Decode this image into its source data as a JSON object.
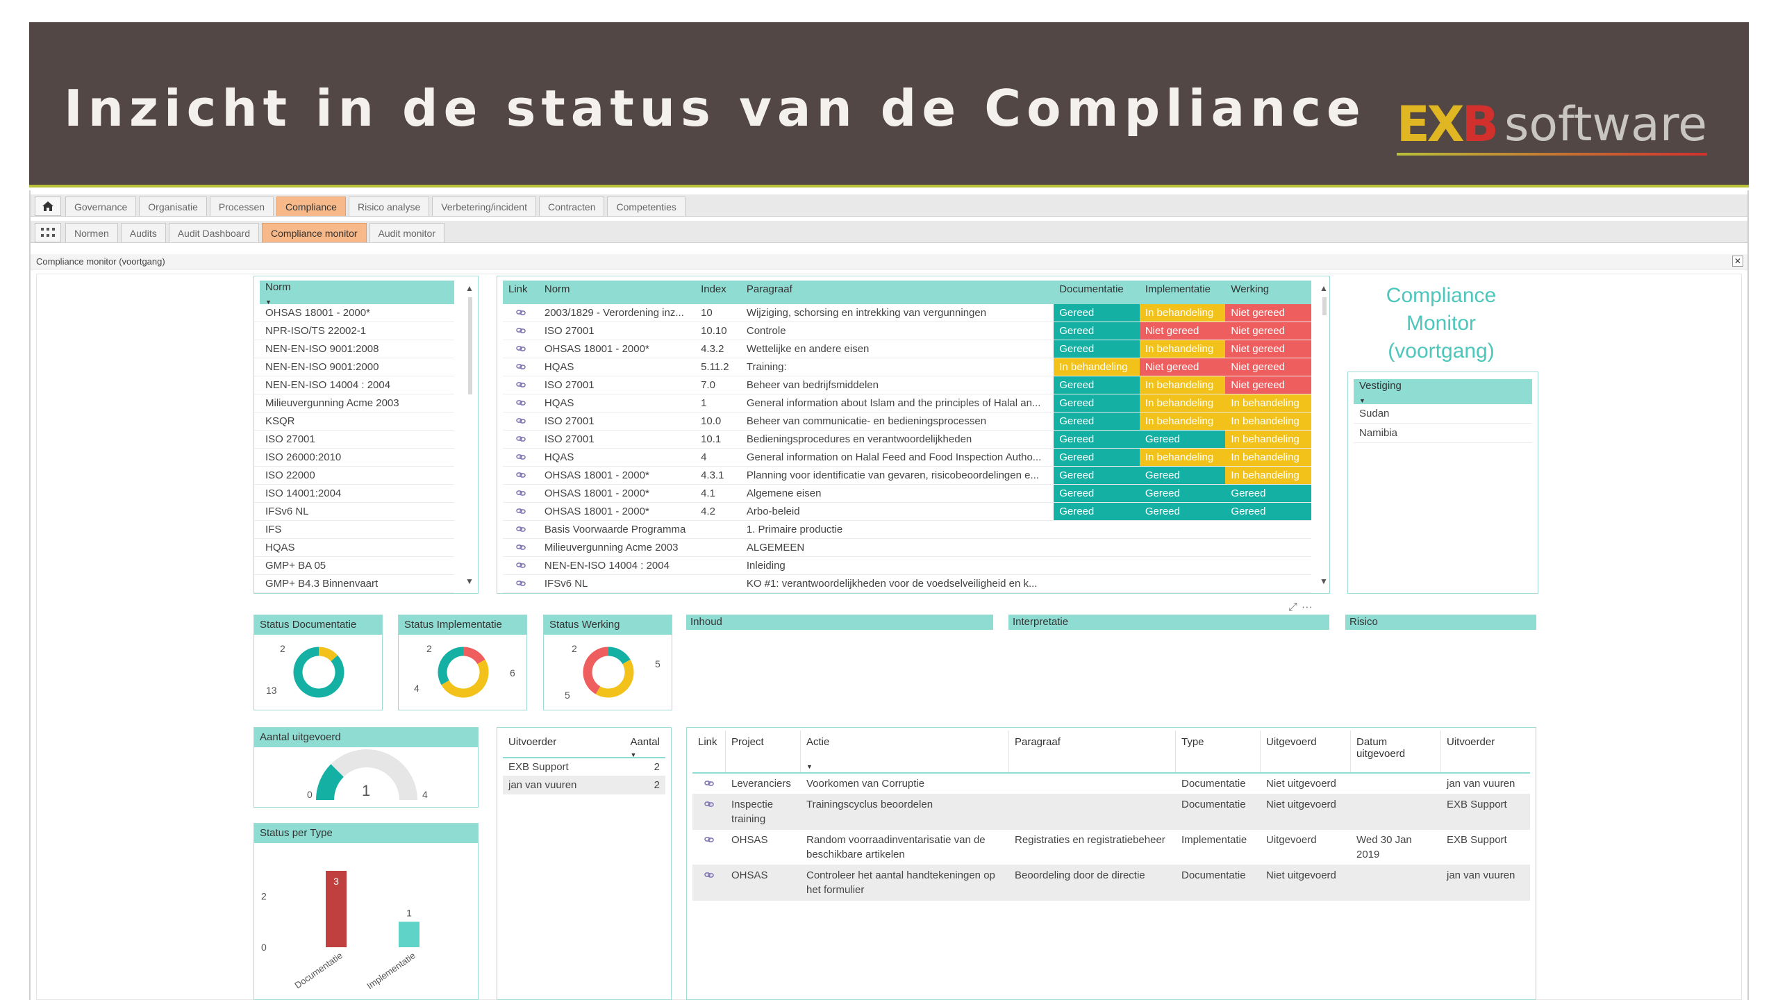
{
  "banner": {
    "title": "Inzicht in de status van de Compliance",
    "logo_ex": "EX",
    "logo_b": "B",
    "logo_software": "software"
  },
  "tabs_top": [
    {
      "label": "Governance"
    },
    {
      "label": "Organisatie"
    },
    {
      "label": "Processen"
    },
    {
      "label": "Compliance",
      "active": true
    },
    {
      "label": "Risico analyse"
    },
    {
      "label": "Verbetering/incident"
    },
    {
      "label": "Contracten"
    },
    {
      "label": "Competenties"
    }
  ],
  "tabs_sub": [
    {
      "label": "Normen"
    },
    {
      "label": "Audits"
    },
    {
      "label": "Audit Dashboard"
    },
    {
      "label": "Compliance monitor",
      "active": true
    },
    {
      "label": "Audit monitor"
    }
  ],
  "page_title": "Compliance monitor (voortgang)",
  "icons": {
    "home": "home-icon",
    "apps": "grid-icon",
    "close": "close-icon",
    "link": "link-icon"
  },
  "norm_list": {
    "header": "Norm",
    "items": [
      "OHSAS 18001 - 2000*",
      "NPR-ISO/TS 22002-1",
      "NEN-EN-ISO 9001:2008",
      "NEN-EN-ISO 9001:2000",
      "NEN-EN-ISO 14004 : 2004",
      "Milieuvergunning Acme 2003",
      "KSQR",
      "ISO 27001",
      "ISO 26000:2010",
      "ISO 22000",
      "ISO 14001:2004",
      "IFSv6 NL",
      "IFS",
      "HQAS",
      "GMP+ BA 05",
      "GMP+ B4.3 Binnenvaart"
    ]
  },
  "norm_table": {
    "headers": {
      "link": "Link",
      "norm": "Norm",
      "index": "Index",
      "paragraaf": "Paragraaf",
      "doc": "Documentatie",
      "impl": "Implementatie",
      "werk": "Werking"
    },
    "rows": [
      {
        "norm": "2003/1829 - Verordening inz...",
        "index": "10",
        "par": "Wijziging, schorsing en intrekking van vergunningen",
        "doc": "Gereed",
        "impl": "In behandeling",
        "werk": "Niet gereed"
      },
      {
        "norm": "ISO 27001",
        "index": "10.10",
        "par": "Controle",
        "doc": "Gereed",
        "impl": "Niet gereed",
        "werk": "Niet gereed"
      },
      {
        "norm": "OHSAS 18001 - 2000*",
        "index": "4.3.2",
        "par": "Wettelijke en andere eisen",
        "doc": "Gereed",
        "impl": "In behandeling",
        "werk": "Niet gereed"
      },
      {
        "norm": "HQAS",
        "index": "5.11.2",
        "par": "Training:",
        "doc": "In behandeling",
        "impl": "Niet gereed",
        "werk": "Niet gereed"
      },
      {
        "norm": "ISO 27001",
        "index": "7.0",
        "par": "Beheer van bedrijfsmiddelen",
        "doc": "Gereed",
        "impl": "In behandeling",
        "werk": "Niet gereed"
      },
      {
        "norm": "HQAS",
        "index": "1",
        "par": "General information about Islam and the principles of Halal an...",
        "doc": "Gereed",
        "impl": "In behandeling",
        "werk": "In behandeling"
      },
      {
        "norm": "ISO 27001",
        "index": "10.0",
        "par": "Beheer van communicatie- en bedieningsprocessen",
        "doc": "Gereed",
        "impl": "In behandeling",
        "werk": "In behandeling"
      },
      {
        "norm": "ISO 27001",
        "index": "10.1",
        "par": "Bedieningsprocedures en verantwoordelijkheden",
        "doc": "Gereed",
        "impl": "Gereed",
        "werk": "In behandeling"
      },
      {
        "norm": "HQAS",
        "index": "4",
        "par": "General information on Halal Feed and Food Inspection Autho...",
        "doc": "Gereed",
        "impl": "In behandeling",
        "werk": "In behandeling"
      },
      {
        "norm": "OHSAS 18001 - 2000*",
        "index": "4.3.1",
        "par": "Planning voor identificatie van gevaren, risicobeoordelingen e...",
        "doc": "Gereed",
        "impl": "Gereed",
        "werk": "In behandeling"
      },
      {
        "norm": "OHSAS 18001 - 2000*",
        "index": "4.1",
        "par": "Algemene eisen",
        "doc": "Gereed",
        "impl": "Gereed",
        "werk": "Gereed"
      },
      {
        "norm": "OHSAS 18001 - 2000*",
        "index": "4.2",
        "par": "Arbo-beleid",
        "doc": "Gereed",
        "impl": "Gereed",
        "werk": "Gereed"
      },
      {
        "norm": "Basis Voorwaarde Programma",
        "index": "",
        "par": "1. Primaire productie",
        "doc": "",
        "impl": "",
        "werk": ""
      },
      {
        "norm": "Milieuvergunning Acme 2003",
        "index": "",
        "par": "ALGEMEEN",
        "doc": "",
        "impl": "",
        "werk": ""
      },
      {
        "norm": "NEN-EN-ISO 14004 : 2004",
        "index": "",
        "par": "Inleiding",
        "doc": "",
        "impl": "",
        "werk": ""
      },
      {
        "norm": "IFSv6 NL",
        "index": "",
        "par": "KO #1: verantwoordelijkheden voor de voedselveiligheid en k...",
        "doc": "",
        "impl": "",
        "werk": ""
      }
    ]
  },
  "compliance_title": [
    "Compliance",
    "Monitor",
    "(voortgang)"
  ],
  "vestiging": {
    "header": "Vestiging",
    "items": [
      "Sudan",
      "Namibia"
    ]
  },
  "status_colors": {
    "Gereed": "#14b0a4",
    "In behandeling": "#f2c21a",
    "Niet gereed": "#ef5e5e"
  },
  "donuts": [
    {
      "title": "Status Documentatie",
      "labels": [
        "2",
        "13"
      ],
      "values": [
        2,
        13
      ],
      "colors": [
        "#f2c21a",
        "#14b0a4"
      ]
    },
    {
      "title": "Status Implementatie",
      "labels": [
        "2",
        "6",
        "4"
      ],
      "values": [
        2,
        6,
        4
      ],
      "colors": [
        "#ef5e5e",
        "#f2c21a",
        "#14b0a4"
      ]
    },
    {
      "title": "Status Werking",
      "labels": [
        "2",
        "5",
        "5"
      ],
      "values": [
        2,
        5,
        5
      ],
      "colors": [
        "#14b0a4",
        "#f2c21a",
        "#ef5e5e"
      ]
    }
  ],
  "strips": {
    "inhoud": "Inhoud",
    "interpretatie": "Interpretatie",
    "risico": "Risico"
  },
  "gauge": {
    "title": "Aantal uitgevoerd",
    "min": "0",
    "value": "1",
    "max": "4",
    "value_num": 1,
    "max_num": 4
  },
  "chart_data": {
    "type": "bar",
    "title": "Status per Type",
    "categories": [
      "Documentatie",
      "Implementatie"
    ],
    "values": [
      3,
      1
    ],
    "colors": [
      "#c0403f",
      "#5fd3c8"
    ],
    "ylim": [
      0,
      3
    ],
    "yticks": [
      "0",
      "2"
    ],
    "data_labels": [
      "3",
      "1"
    ]
  },
  "uitvoerder": {
    "headers": {
      "name": "Uitvoerder",
      "count": "Aantal"
    },
    "rows": [
      {
        "name": "EXB Support",
        "count": "2"
      },
      {
        "name": "jan van vuuren",
        "count": "2"
      }
    ]
  },
  "acties": {
    "headers": {
      "link": "Link",
      "project": "Project",
      "actie": "Actie",
      "paragraaf": "Paragraaf",
      "type": "Type",
      "uitgevoerd": "Uitgevoerd",
      "datum": "Datum uitgevoerd",
      "uitvoerder": "Uitvoerder"
    },
    "rows": [
      {
        "project": "Leveranciers",
        "actie": "Voorkomen van Corruptie",
        "paragraaf": "",
        "type": "Documentatie",
        "uitgevoerd": "Niet uitgevoerd",
        "datum": "",
        "uitvoerder": "jan van vuuren"
      },
      {
        "project": "Inspectie training",
        "actie": "Trainingscyclus beoordelen",
        "paragraaf": "",
        "type": "Documentatie",
        "uitgevoerd": "Niet uitgevoerd",
        "datum": "",
        "uitvoerder": "EXB Support"
      },
      {
        "project": "OHSAS",
        "actie": "Random voorraadinventarisatie van de beschikbare artikelen",
        "paragraaf": "Registraties en registratiebeheer",
        "type": "Implementatie",
        "uitgevoerd": "Uitgevoerd",
        "datum": "Wed 30 Jan 2019",
        "uitvoerder": "EXB Support"
      },
      {
        "project": "OHSAS",
        "actie": "Controleer het aantal handtekeningen op het formulier",
        "paragraaf": "Beoordeling door de directie",
        "type": "Documentatie",
        "uitgevoerd": "Niet uitgevoerd",
        "datum": "",
        "uitvoerder": "jan van vuuren"
      }
    ]
  }
}
